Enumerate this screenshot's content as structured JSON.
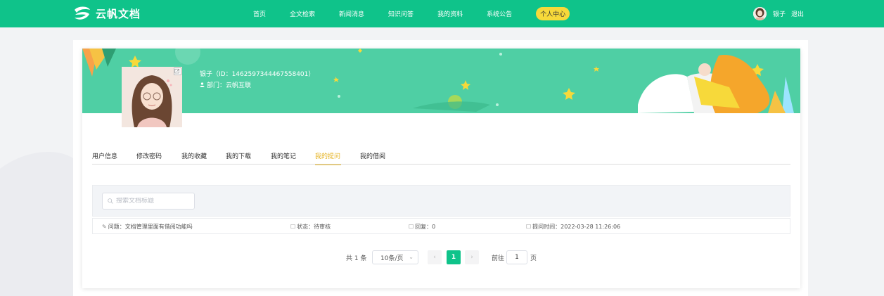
{
  "app": {
    "logo_text": "云帆文档"
  },
  "nav": {
    "items": [
      {
        "label": "首页"
      },
      {
        "label": "全文检索"
      },
      {
        "label": "新闻消息"
      },
      {
        "label": "知识问答"
      },
      {
        "label": "我的资料"
      },
      {
        "label": "系统公告"
      },
      {
        "label": "个人中心"
      }
    ],
    "active_index": 6
  },
  "user": {
    "name": "银子",
    "logout_label": "退出"
  },
  "profile": {
    "name_id": "银子（ID：1462597344467558401）",
    "dept": "部门：云帆互联"
  },
  "tabs": {
    "items": [
      {
        "label": "用户信息"
      },
      {
        "label": "修改密码"
      },
      {
        "label": "我的收藏"
      },
      {
        "label": "我的下载"
      },
      {
        "label": "我的笔记"
      },
      {
        "label": "我的提问"
      },
      {
        "label": "我的借阅"
      }
    ],
    "active_index": 5
  },
  "search": {
    "placeholder": "搜索文档标题",
    "value": ""
  },
  "questions": [
    {
      "question": "问题：文档管理里面有借阅功能吗",
      "status": "状态：待审核",
      "replies": "回复：0",
      "time": "提问时间：2022-03-28 11:26:06"
    }
  ],
  "pagination": {
    "total": "共 1 条",
    "page_size": "10条/页",
    "current_page": "1",
    "goto_label": "前往",
    "goto_value": "1",
    "goto_suffix": "页"
  },
  "colors": {
    "primary": "#0fc38a",
    "banner": "#4fcfa4",
    "active_badge": "#f7d93a",
    "active_tab": "#e5b21f"
  }
}
